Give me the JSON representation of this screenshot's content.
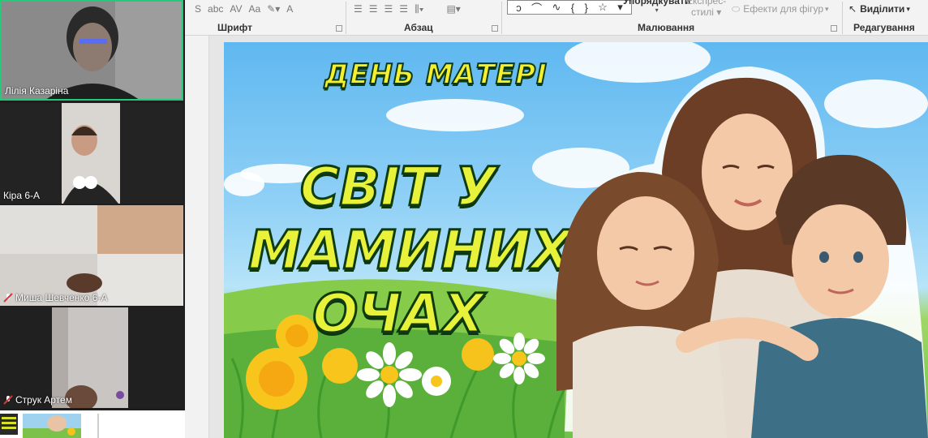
{
  "ribbon": {
    "font_group_label": "Шрифт",
    "paragraph_group_label": "Абзац",
    "drawing_group_label": "Малювання",
    "editing_group_label": "Редагування",
    "arrange_label": "Упорядкувати",
    "quick_styles_label": "Експрес-стилі",
    "quick_styles_line2": "стилі",
    "shape_effects_label": "Ефекти для фігур",
    "select_label": "Виділити",
    "font_size_btn": "Aa",
    "font_color_btn": "A",
    "bold_s": "S",
    "abc_btn": "abc",
    "av_btn": "AV"
  },
  "participants": [
    {
      "name": "Лілія Казаріна",
      "muted": false,
      "active_speaker": true
    },
    {
      "name": "Кіра 6-А",
      "muted": false,
      "active_speaker": false
    },
    {
      "name": "Миша Шевченко 6-А",
      "muted": true,
      "active_speaker": false
    },
    {
      "name": "Струк Артем",
      "muted": true,
      "active_speaker": false
    }
  ],
  "slide": {
    "subtitle": "ДЕНЬ МАТЕРІ",
    "title_line1": "СВІТ У",
    "title_line2": "МАМИНИХ",
    "title_line3": "ОЧАХ"
  },
  "colors": {
    "active_speaker_border": "#26c97a",
    "title_fill": "#e8f23a",
    "title_outline": "#0f3b10",
    "sky": "#8fd0f6",
    "grass": "#6fc24a"
  }
}
